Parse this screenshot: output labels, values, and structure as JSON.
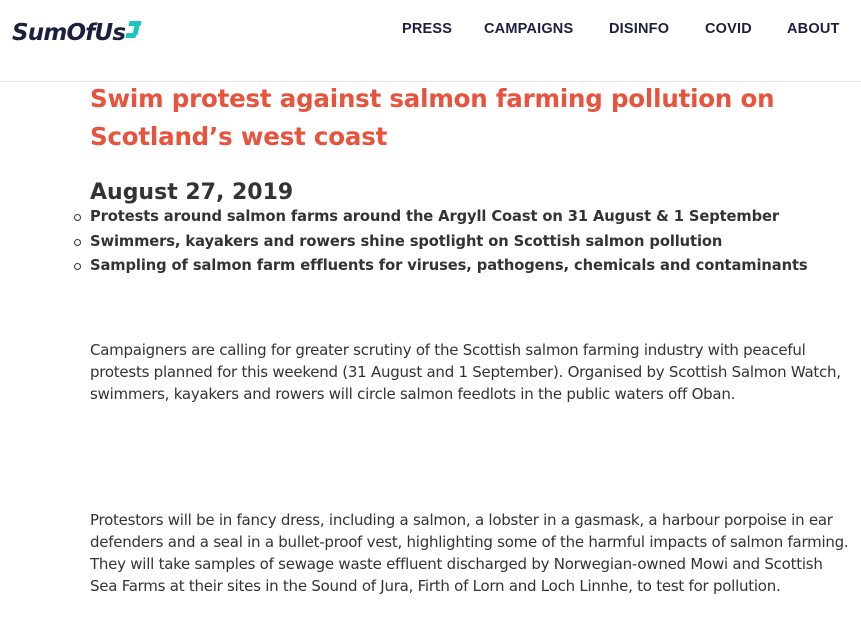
{
  "header": {
    "logo": {
      "text": "SumOfUs",
      "mark_color": "#1bc5c0",
      "text_color": "#1c1f3e"
    },
    "nav": [
      {
        "label": "PRESS"
      },
      {
        "label": "CAMPAIGNS"
      },
      {
        "label": "DISINFO"
      },
      {
        "label": "COVID"
      },
      {
        "label": "ABOUT"
      }
    ]
  },
  "article": {
    "title": "Swim protest against salmon farming pollution on Scotland’s west coast",
    "title_color": "#e8533d",
    "date": "August 27, 2019",
    "highlights": [
      "Protests around salmon farms around the Argyll Coast on 31 August & 1 September",
      "Swimmers, kayakers and rowers shine spotlight on Scottish salmon pollution",
      "Sampling of salmon farm effluents for viruses, pathogens, chemicals and contaminants"
    ],
    "paragraphs": [
      "Campaigners are calling for greater scrutiny of the Scottish salmon farming industry with peaceful protests planned for this weekend (31 August and 1 September). Organised by Scottish Salmon Watch, swimmers, kayakers and rowers will circle salmon feedlots in the public waters off Oban.",
      "Protestors will be in fancy dress, including a salmon, a lobster in a gasmask, a harbour porpoise in ear defenders and a seal in a bullet-proof vest, highlighting some of the harmful impacts of salmon farming. They will take samples of sewage waste effluent discharged by Norwegian-owned Mowi and Scottish Sea Farms at their sites in the Sound of Jura, Firth of Lorn and Loch Linnhe, to test for pollution."
    ]
  }
}
